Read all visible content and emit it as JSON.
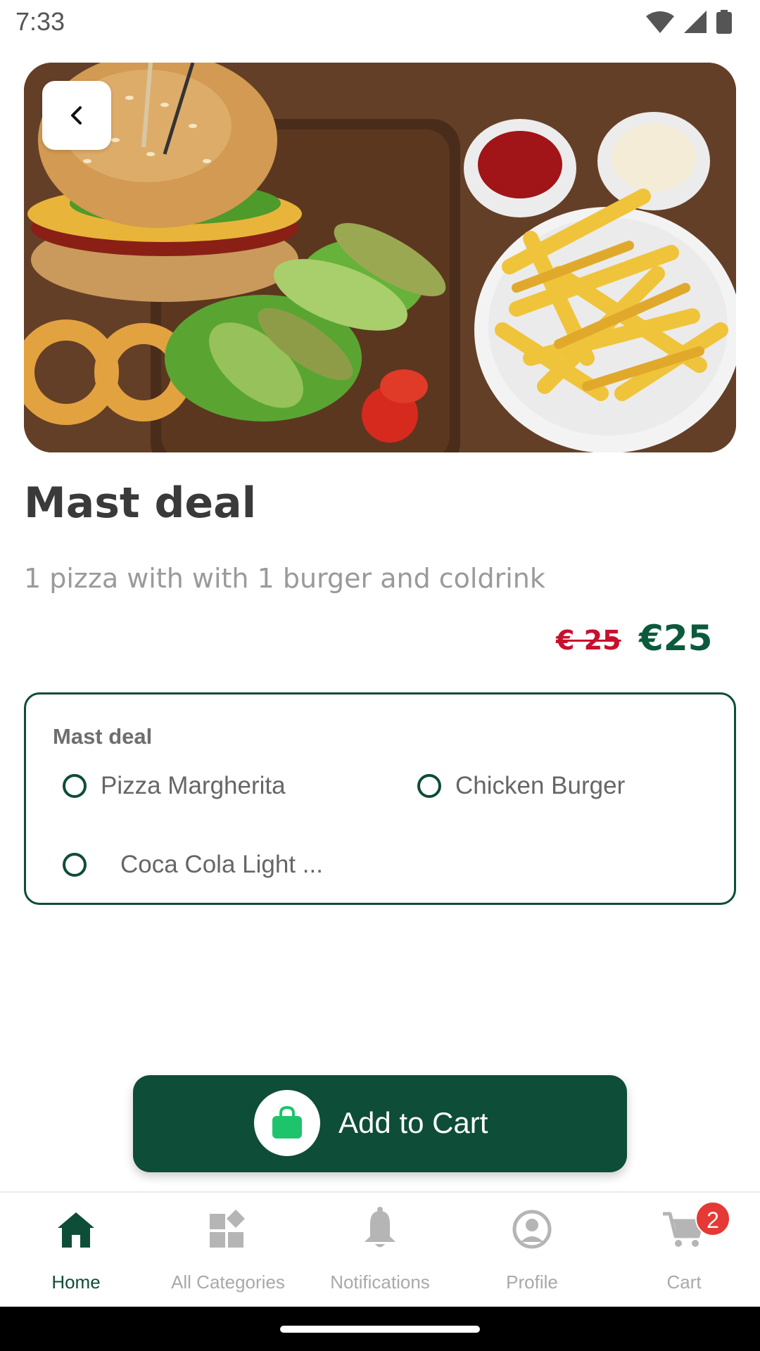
{
  "status_bar": {
    "time": "7:33"
  },
  "hero": {
    "back_icon": "chevron-left-icon"
  },
  "product": {
    "title": "Mast deal",
    "description": "1 pizza with with 1 burger and coldrink",
    "price_old": "€ 25",
    "price_new": "€25"
  },
  "options": {
    "group_title": "Mast deal",
    "items": [
      {
        "label": "Pizza Margherita",
        "selected": false
      },
      {
        "label": "Chicken Burger",
        "selected": false
      },
      {
        "label": "Coca Cola Light ...",
        "selected": false
      }
    ]
  },
  "add_to_cart": {
    "label": "Add to Cart",
    "icon": "shopping-bag-icon"
  },
  "bottom_nav": {
    "items": [
      {
        "label": "Home",
        "icon": "home-icon",
        "active": true
      },
      {
        "label": "All Categories",
        "icon": "categories-icon",
        "active": false
      },
      {
        "label": "Notifications",
        "icon": "bell-icon",
        "active": false
      },
      {
        "label": "Profile",
        "icon": "profile-icon",
        "active": false
      },
      {
        "label": "Cart",
        "icon": "cart-icon",
        "active": false,
        "badge": "2"
      }
    ]
  },
  "colors": {
    "primary": "#0e4d37",
    "price_old": "#c8102e",
    "inactive": "#a9a9a9",
    "badge": "#e53935"
  }
}
